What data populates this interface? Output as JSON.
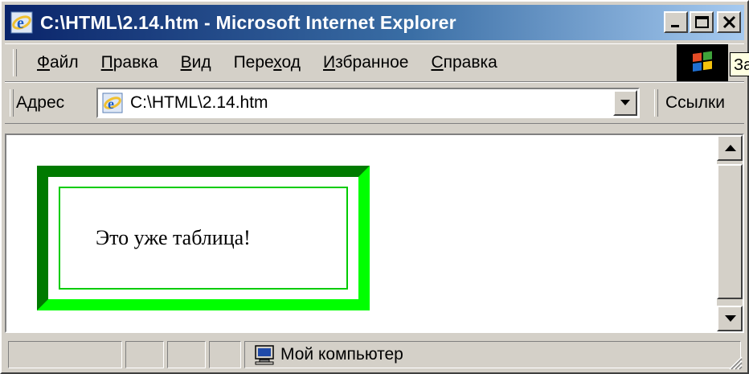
{
  "window": {
    "title": "C:\\HTML\\2.14.htm - Microsoft Internet Explorer",
    "icon": "ie-icon",
    "controls": [
      "minimize-icon",
      "maximize-icon",
      "close-icon"
    ]
  },
  "menu": {
    "items": [
      {
        "accel": "Ф",
        "rest": "айл"
      },
      {
        "accel": "П",
        "rest": "равка"
      },
      {
        "accel": "В",
        "rest": "ид"
      },
      {
        "pre": "Пере",
        "accel": "х",
        "rest": "од"
      },
      {
        "accel": "И",
        "rest": "збранное"
      },
      {
        "accel": "С",
        "rest": "правка"
      }
    ],
    "tooltip": "За"
  },
  "address": {
    "label": "Адрес",
    "value": "C:\\HTML\\2.14.htm",
    "links_label": "Ссылки"
  },
  "content": {
    "table_text": "Это уже таблица!",
    "colors": {
      "border_light": "#00ff00",
      "border_dark": "#007a00",
      "cell_border": "#00cc00"
    }
  },
  "status": {
    "zone_text": "Мой компьютер",
    "zone_icon": "computer-icon"
  }
}
